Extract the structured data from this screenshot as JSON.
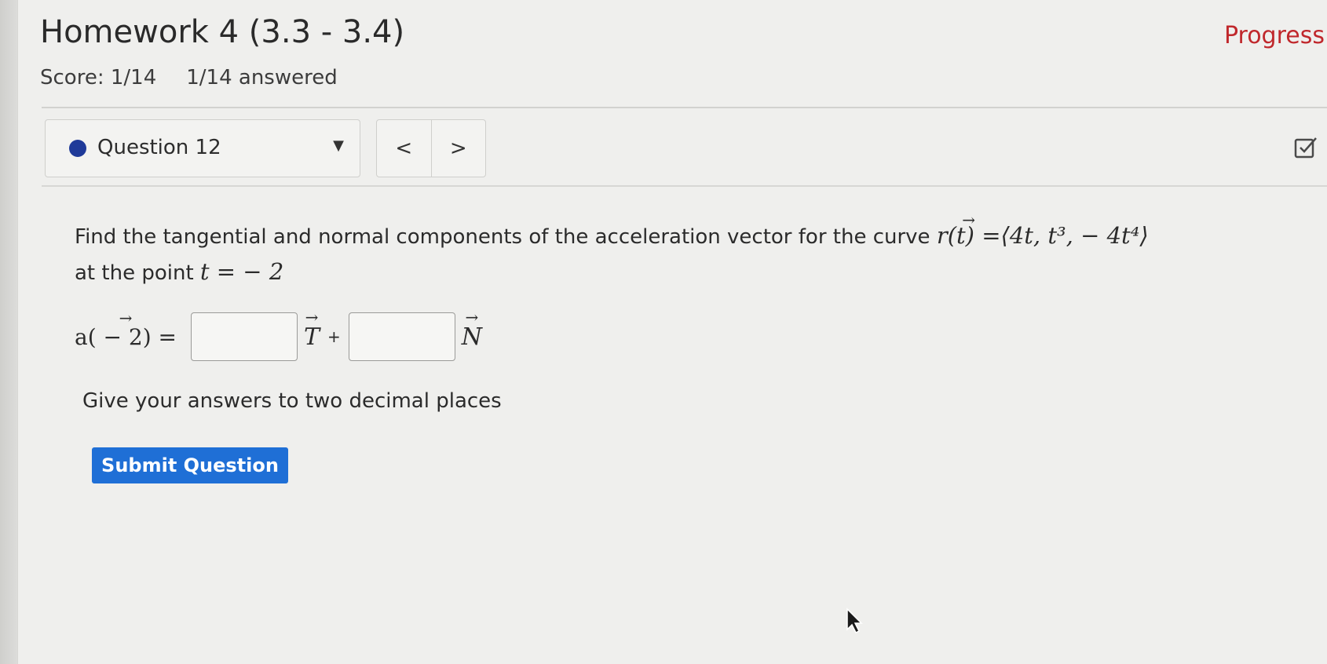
{
  "header": {
    "title": "Homework 4 (3.3 - 3.4)",
    "progress_link": "Progress",
    "score": "Score: 1/14",
    "answered": "1/14 answered"
  },
  "question_nav": {
    "selected": "Question 12",
    "prev": "<",
    "next": ">"
  },
  "question": {
    "prompt_prefix": "Find the tangential and normal components of the acceleration vector for the curve ",
    "curve_lhs": "r(t) = ",
    "curve_rhs": "⟨4t, t³, − 4t⁴⟩",
    "prompt_line2": "at the point ",
    "point": "t = − 2",
    "answer_lhs": "a( − 2) =",
    "t_unit": "T",
    "plus": "+",
    "n_unit": "N",
    "tangential_value": "",
    "normal_value": "",
    "hint": "Give your answers to two decimal places"
  },
  "actions": {
    "submit_label": "Submit Question"
  },
  "colors": {
    "accent": "#1f6fd6",
    "progress": "#c0282c",
    "question_dot": "#1f3a99"
  }
}
